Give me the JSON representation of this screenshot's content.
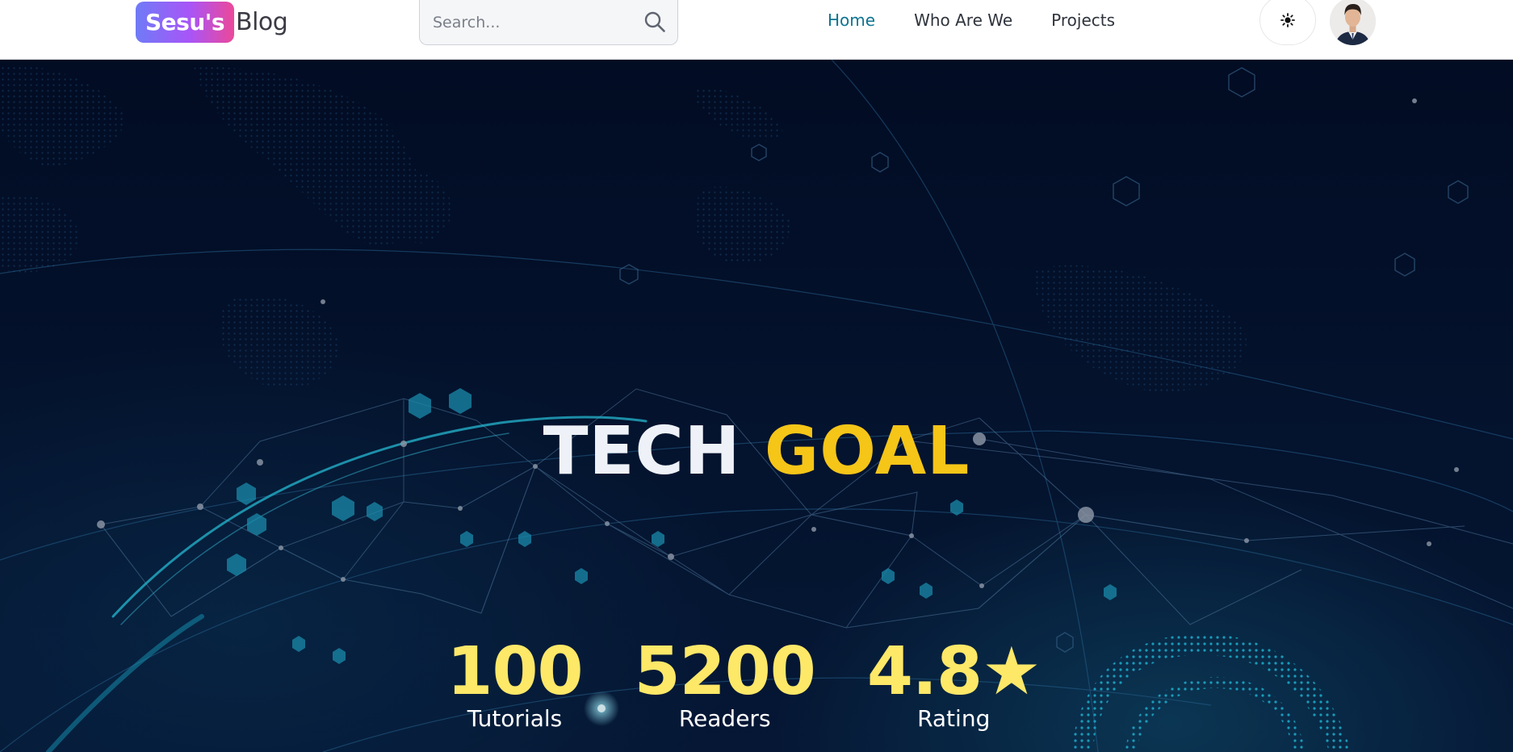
{
  "navbar": {
    "logo_badge": "Sesu's",
    "logo_text": "Blog",
    "search_placeholder": "Search...",
    "links": [
      {
        "label": "Home",
        "active": true
      },
      {
        "label": "Who Are We",
        "active": false
      },
      {
        "label": "Projects",
        "active": false
      }
    ],
    "theme_toggle_icon": "sun-icon",
    "avatar_icon": "user-avatar"
  },
  "hero": {
    "title_word_1": "TECH",
    "title_word_2": "GOAL",
    "stats": [
      {
        "value": "100",
        "label": "Tutorials"
      },
      {
        "value": "5200",
        "label": "Readers"
      },
      {
        "value": "4.8★",
        "label": "Rating"
      }
    ]
  },
  "colors": {
    "accent_active_link": "#0e7490",
    "title_highlight": "#f5c518",
    "stat_value": "#fde868",
    "hero_bg": "#051530"
  }
}
